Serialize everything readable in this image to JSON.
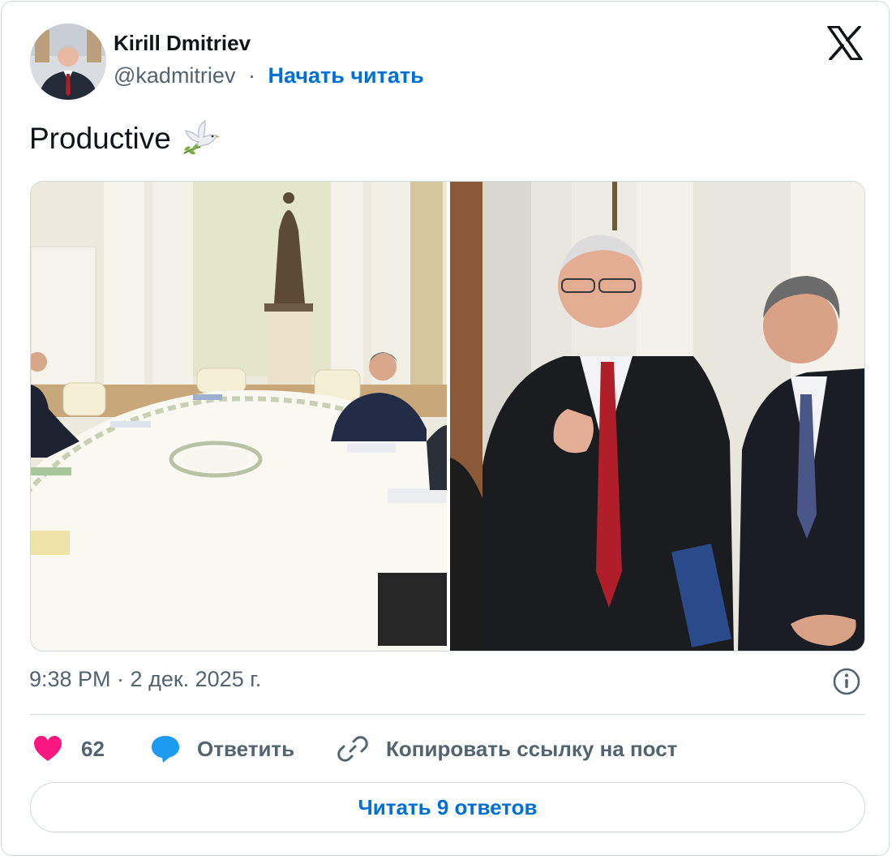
{
  "author": {
    "name": "Kirill Dmitriev",
    "handle": "@kadmitriev",
    "separator": "·",
    "follow_label": "Начать читать",
    "avatar_icon": "avatar-photo"
  },
  "platform_icon": "x-logo-icon",
  "tweet": {
    "text": "Productive",
    "emoji_icon": "dove-with-olive-branch-icon"
  },
  "media": {
    "count": 2
  },
  "meta": {
    "timestamp": "9:38 PM · 2 дек. 2025 г.",
    "info_icon": "info-icon"
  },
  "actions": {
    "likes_count": "62",
    "reply_label": "Ответить",
    "copy_label": "Копировать ссылку на пост"
  },
  "read_replies_label": "Читать 9 ответов",
  "colors": {
    "accent": "#006fd6",
    "like": "#f91880",
    "reply_icon": "#1d9bf0",
    "muted": "#536471",
    "border": "#cfd9de"
  }
}
